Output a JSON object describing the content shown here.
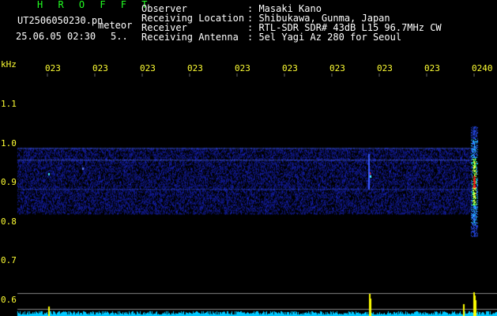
{
  "header": {
    "title": "H R O F F T",
    "filename": "UT2506050230.pn",
    "filename_suffix": "meteor",
    "datetime": "25.06.05 02:30",
    "datetime_suffix": "5..",
    "fields": [
      {
        "label": "Observer",
        "value": ": Masaki Kano"
      },
      {
        "label": "Receiving Location",
        "value": ": Shibukawa, Gunma, Japan"
      },
      {
        "label": "Receiver",
        "value": ": RTL-SDR SDR# 43dB L15 96.7MHz CW"
      },
      {
        "label": "Receiving Antenna",
        "value": ": 5el Yagi Az 280 for Seoul"
      }
    ]
  },
  "time_axis": {
    "labels": [
      "023",
      "023",
      "023",
      "023",
      "023",
      "023",
      "023",
      "023",
      "023",
      "0240"
    ]
  },
  "freq_axis": {
    "unit": "kHz",
    "labels": [
      "1.1",
      "1.0",
      "0.9",
      "0.8",
      "0.7",
      "0.6"
    ]
  },
  "colors": {
    "background": "#000000",
    "text": "#ffffff",
    "title": "#22ff22",
    "axis_labels": "#ffff33",
    "noise_band": "#1a2bd6",
    "baseline": "#00c8ff",
    "peaks": "#ffff00"
  }
}
